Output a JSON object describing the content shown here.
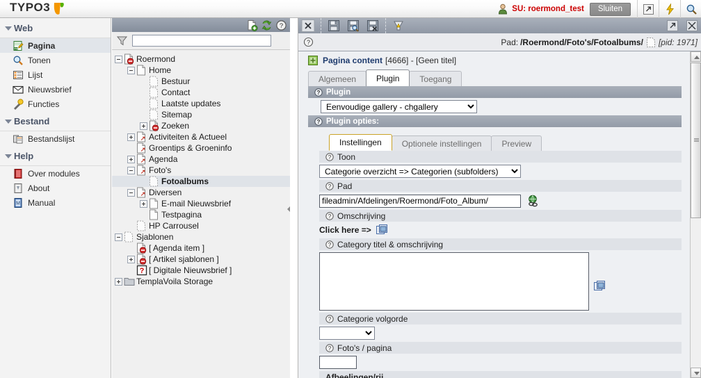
{
  "topbar": {
    "logo_text": "TYPO3",
    "logo_icon": "typo3-logo-icon",
    "user_icon": "user-icon",
    "su_label": "SU:  roermond_test",
    "logout_label": "Sluiten",
    "icons": [
      {
        "name": "open-in-new-window-icon",
        "glyph": "↗"
      },
      {
        "name": "clear-cache-flash-icon",
        "glyph": "⚡"
      },
      {
        "name": "search-magnifier-icon",
        "glyph": "🔍"
      }
    ]
  },
  "modulemenu": {
    "sections": [
      {
        "name": "web",
        "label": "Web",
        "items": [
          {
            "label": "Pagina",
            "icon": "page-module-icon",
            "active": true
          },
          {
            "label": "Tonen",
            "icon": "view-magnifier-icon",
            "active": false
          },
          {
            "label": "Lijst",
            "icon": "list-module-icon",
            "active": false
          },
          {
            "label": "Nieuwsbrief",
            "icon": "envelope-newsletter-icon",
            "active": false
          },
          {
            "label": "Functies",
            "icon": "magic-wand-functions-icon",
            "active": false
          }
        ]
      },
      {
        "name": "bestand",
        "label": "Bestand",
        "items": [
          {
            "label": "Bestandslijst",
            "icon": "filelist-module-icon",
            "active": false
          }
        ]
      },
      {
        "name": "help",
        "label": "Help",
        "items": [
          {
            "label": "Over modules",
            "icon": "about-modules-book-icon",
            "active": false
          },
          {
            "label": "About",
            "icon": "about-info-icon",
            "active": false
          },
          {
            "label": "Manual",
            "icon": "manual-book-icon",
            "active": false
          }
        ]
      }
    ]
  },
  "treepanel": {
    "toolbar_icons": [
      {
        "name": "new-page-icon"
      },
      {
        "name": "refresh-tree-icon"
      },
      {
        "name": "help-question-icon"
      }
    ],
    "filter": {
      "icon": "filter-funnel-icon",
      "value": "",
      "placeholder": ""
    },
    "collapse_handle": "tree-collapse-handle",
    "nodes": [
      {
        "label": "Roermond",
        "depth": 0,
        "toggle": "minus",
        "icon": "page-hidden-icon",
        "selected": false
      },
      {
        "label": "Home",
        "depth": 1,
        "toggle": "minus",
        "icon": "page-icon",
        "selected": false
      },
      {
        "label": "Bestuur",
        "depth": 2,
        "toggle": "none",
        "icon": "page-dashed-icon",
        "selected": false
      },
      {
        "label": "Contact",
        "depth": 2,
        "toggle": "none",
        "icon": "page-dashed-icon",
        "selected": false
      },
      {
        "label": "Laatste updates",
        "depth": 2,
        "toggle": "none",
        "icon": "page-dashed-icon",
        "selected": false
      },
      {
        "label": "Sitemap",
        "depth": 2,
        "toggle": "none",
        "icon": "page-dashed-icon",
        "selected": false
      },
      {
        "label": "Zoeken",
        "depth": 2,
        "toggle": "plus",
        "icon": "page-hidden-icon",
        "selected": false
      },
      {
        "label": "Activiteiten & Actueel",
        "depth": 1,
        "toggle": "plus",
        "icon": "page-shortcut-icon",
        "selected": false
      },
      {
        "label": "Groentips & Groeninfo",
        "depth": 1,
        "toggle": "none",
        "icon": "page-shortcut-icon",
        "selected": false
      },
      {
        "label": "Agenda",
        "depth": 1,
        "toggle": "plus",
        "icon": "page-shortcut-icon",
        "selected": false
      },
      {
        "label": "Foto's",
        "depth": 1,
        "toggle": "minus",
        "icon": "page-shortcut-icon",
        "selected": false
      },
      {
        "label": "Fotoalbums",
        "depth": 2,
        "toggle": "none",
        "icon": "page-dashed-icon",
        "selected": true
      },
      {
        "label": "Diversen",
        "depth": 1,
        "toggle": "minus",
        "icon": "page-shortcut-icon",
        "selected": false
      },
      {
        "label": "E-mail Nieuwsbrief",
        "depth": 2,
        "toggle": "plus",
        "icon": "page-icon",
        "selected": false
      },
      {
        "label": "Testpagina",
        "depth": 2,
        "toggle": "none",
        "icon": "page-icon",
        "selected": false
      },
      {
        "label": "HP Carrousel",
        "depth": 1,
        "toggle": "none",
        "icon": "page-dashed-icon",
        "selected": false
      },
      {
        "label": "Sjablonen",
        "depth": 0,
        "toggle": "minus",
        "icon": "page-dashed-icon",
        "selected": false
      },
      {
        "label": "[ Agenda item ]",
        "depth": 1,
        "toggle": "none",
        "icon": "page-hidden-icon",
        "selected": false
      },
      {
        "label": "[ Artikel sjablonen ]",
        "depth": 1,
        "toggle": "plus",
        "icon": "page-hidden-icon",
        "selected": false
      },
      {
        "label": "[ Digitale Nieuwsbrief ]",
        "depth": 1,
        "toggle": "none",
        "icon": "page-unknown-icon",
        "selected": false
      },
      {
        "label": "TemplaVoila Storage",
        "depth": 0,
        "toggle": "plus",
        "icon": "folder-icon",
        "selected": false
      }
    ]
  },
  "detail": {
    "toolbar": [
      {
        "name": "close-document-icon",
        "label": "Sluiten"
      },
      {
        "name": "save-document-icon",
        "label": "Opslaan"
      },
      {
        "name": "save-and-view-icon",
        "label": "Opslaan en bekijken"
      },
      {
        "name": "save-and-close-icon",
        "label": "Opslaan en sluiten"
      },
      {
        "name": "undo-history-icon",
        "label": "Geschiedenis"
      },
      {
        "name": "open-in-new-window-icon",
        "label": "Nieuw venster"
      },
      {
        "name": "fullscreen-icon",
        "label": "Volledig scherm"
      }
    ],
    "path": {
      "help_icon": "help-question-icon",
      "label": "Pad:",
      "value": "/Roermond/Foto's/Fotoalbums/",
      "doc_icon": "page-dashed-icon",
      "pid": "[pid: 1971]"
    },
    "record_header": {
      "icon": "content-element-icon",
      "title": "Pagina content",
      "rest": "[4666] - [Geen titel]"
    },
    "tabs": [
      {
        "label": "Algemeen",
        "active": false
      },
      {
        "label": "Plugin",
        "active": true
      },
      {
        "label": "Toegang",
        "active": false
      }
    ],
    "plugin_section": {
      "label": "Plugin",
      "help_icon": "help-question-icon",
      "select_value": "Eenvoudige gallery - chgallery",
      "options": [
        "Eenvoudige gallery - chgallery"
      ]
    },
    "plugin_options_section": {
      "label": "Plugin opties:",
      "help_icon": "help-question-icon"
    },
    "inner_tabs": [
      {
        "label": "Instellingen",
        "active": true
      },
      {
        "label": "Optionele instellingen",
        "active": false
      },
      {
        "label": "Preview",
        "active": false
      }
    ],
    "fields": [
      {
        "name": "toon",
        "label": "Toon",
        "type": "select",
        "value": "Categorie overzicht => Categorien (subfolders)",
        "options": [
          "Categorie overzicht => Categorien (subfolders)"
        ]
      },
      {
        "name": "pad",
        "label": "Pad",
        "type": "text-with-browser",
        "value": "fileadmin/Afdelingen/Roermond/Foto_Album/",
        "browse_icon": "folder-browser-globe-icon"
      },
      {
        "name": "omschrijving",
        "label": "Omschrijving",
        "type": "click-here",
        "click_label": "Click here =>",
        "click_icon": "wizard-popup-icon"
      },
      {
        "name": "category-titel-omschrijving",
        "label": "Category titel & omschrijving",
        "type": "textarea",
        "value": "",
        "side_icon": "wizard-popup-icon"
      },
      {
        "name": "categorie-volgorde",
        "label": "Categorie volgorde",
        "type": "select",
        "value": "",
        "options": [
          ""
        ]
      },
      {
        "name": "fotos-per-pagina",
        "label": "Foto's / pagina",
        "type": "text",
        "value": ""
      },
      {
        "name": "afbeelingen-per-rij",
        "label": "Afbeelingen/rij",
        "type": "label-only"
      }
    ]
  },
  "scrollbars": {
    "detail_vertical": {
      "name": "detail-vertical-scrollbar"
    }
  },
  "colors": {
    "accent_blue": "#1f3c6e",
    "su_red": "#cc0000",
    "section_gray": "#939ba7",
    "field_gray": "#dfe2e7",
    "panel_bg": "#eef0f3",
    "tree_bg": "#f0f0f0",
    "module_bg": "#f3f3f3",
    "selected_row": "#dfe3e8",
    "logo_orange": "#f49700"
  }
}
